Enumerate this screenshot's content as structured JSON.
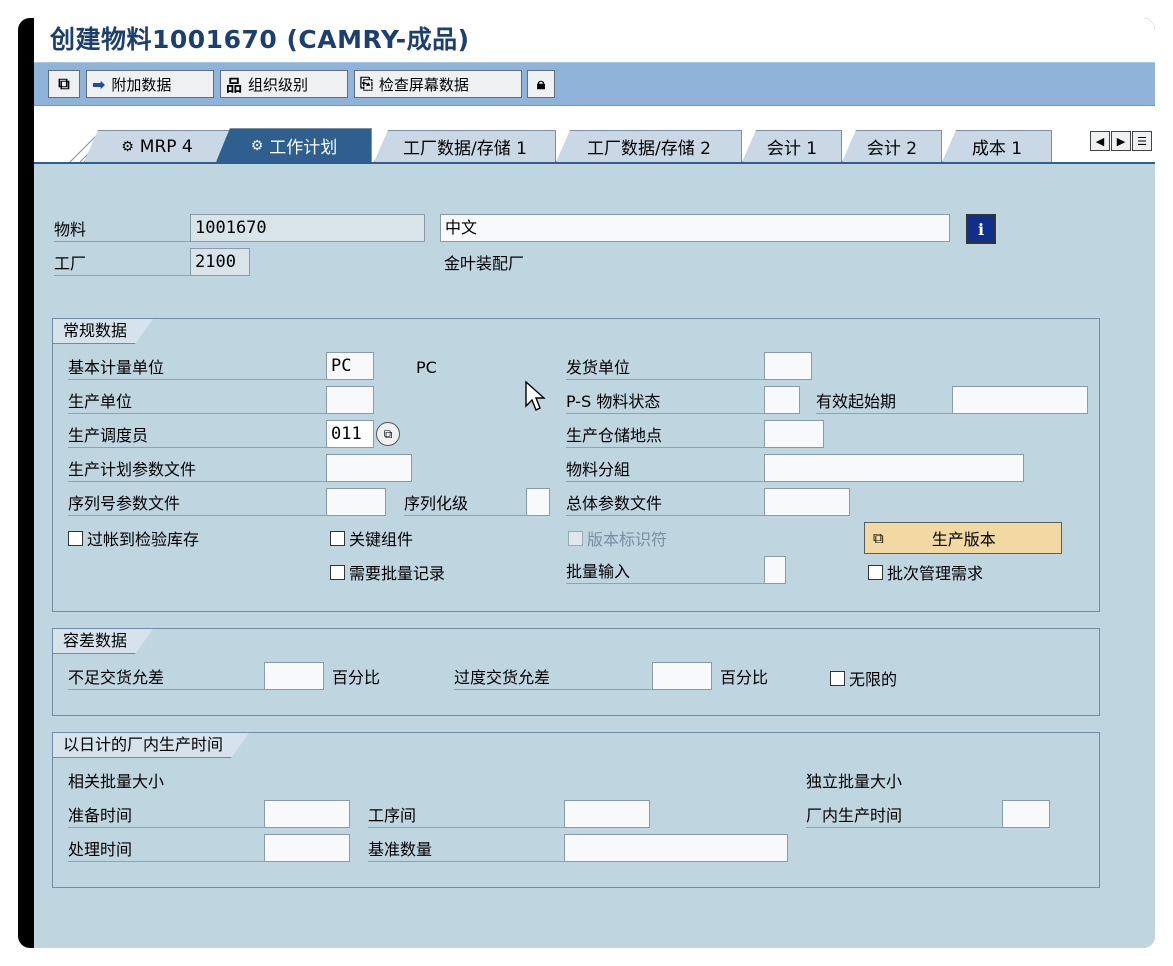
{
  "window": {
    "title": "创建物料1001670 (CAMRY-成品)"
  },
  "toolbar": {
    "btn_other_label": "",
    "btn_additional": "附加数据",
    "btn_org_levels": "组织级别",
    "btn_check_screen": "检查屏幕数据",
    "btn_lock_label": ""
  },
  "tabs": [
    {
      "label": "MRP 4"
    },
    {
      "label": "工作计划"
    },
    {
      "label": "工厂数据/存储 1"
    },
    {
      "label": "工厂数据/存储 2"
    },
    {
      "label": "会计 1"
    },
    {
      "label": "会计 2"
    },
    {
      "label": "成本 1"
    }
  ],
  "header": {
    "material_label": "物料",
    "material_value": "1001670",
    "material_desc": "中文",
    "plant_label": "工厂",
    "plant_value": "2100",
    "plant_name": "金叶装配厂"
  },
  "general": {
    "title": "常规数据",
    "base_uom_label": "基本计量单位",
    "base_uom_value": "PC",
    "base_uom_text": "PC",
    "issue_unit_label": "发货单位",
    "issue_unit_value": "",
    "prod_unit_label": "生产单位",
    "prod_unit_value": "",
    "ps_status_label": "P-S 物料状态",
    "ps_status_value": "",
    "valid_from_label": "有效起始期",
    "valid_from_value": "",
    "scheduler_label": "生产调度员",
    "scheduler_value": "011",
    "storage_loc_label": "生产仓储地点",
    "storage_loc_value": "",
    "profile_label": "生产计划参数文件",
    "profile_value": "",
    "mat_group_label": "物料分組",
    "mat_group_value": "",
    "serial_profile_label": "序列号参数文件",
    "serial_profile_value": "",
    "serial_level_label": "序列化级",
    "serial_level_value": "",
    "overall_profile_label": "总体参数文件",
    "overall_profile_value": "",
    "post_inspection_label": "过帐到检验库存",
    "critical_component_label": "关键组件",
    "version_indicator_label": "版本标识符",
    "prod_version_button": "生产版本",
    "batch_record_label": "需要批量记录",
    "batch_entry_label": "批量输入",
    "batch_entry_value": "",
    "batch_mgmt_label": "批次管理需求"
  },
  "tolerance": {
    "title": "容差数据",
    "under_label": "不足交货允差",
    "under_value": "",
    "under_unit": "百分比",
    "over_label": "过度交货允差",
    "over_value": "",
    "over_unit": "百分比",
    "unlimited_label": "无限的"
  },
  "inhouse": {
    "title": "以日计的厂内生产时间",
    "lot_dependent_label": "相关批量大小",
    "lot_independent_label": "独立批量大小",
    "setup_label": "准备时间",
    "setup_value": "",
    "interop_label": "工序间",
    "interop_value": "",
    "inhouse_time_label": "厂内生产时间",
    "inhouse_time_value": "",
    "processing_label": "处理时间",
    "processing_value": "",
    "base_qty_label": "基准数量",
    "base_qty_value": ""
  }
}
